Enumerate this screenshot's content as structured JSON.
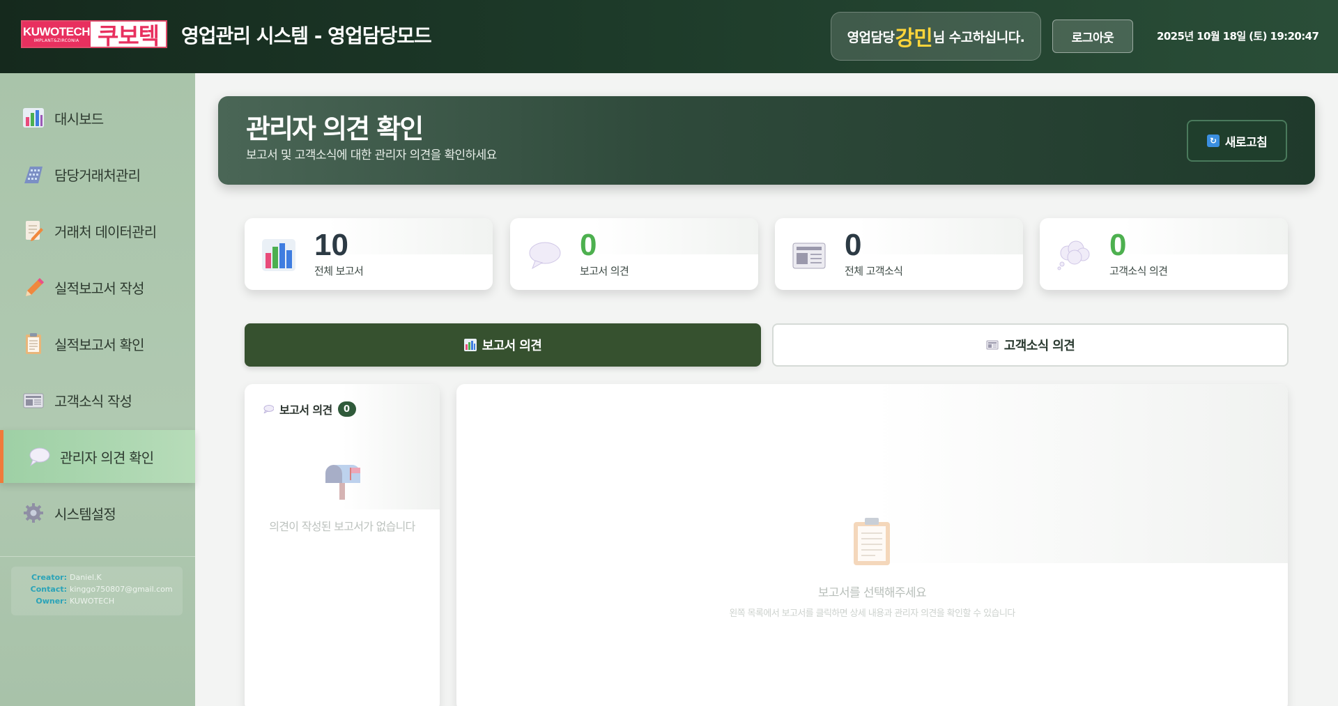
{
  "header": {
    "logo_en": "KUWOTECH",
    "logo_sub": "IMPLANT&ZIRCONIA",
    "logo_kr": "쿠보텍",
    "title": "영업관리 시스템 - 영업담당모드",
    "welcome_pre": "영업담당",
    "welcome_name": "강민",
    "welcome_post": "님 수고하십니다.",
    "logout_label": "로그아웃",
    "datetime": "2025년 10월 18일 (토) 19:20:47"
  },
  "sidebar": {
    "items": [
      {
        "label": "대시보드",
        "icon": "bar-chart-icon"
      },
      {
        "label": "담당거래처관리",
        "icon": "building-icon"
      },
      {
        "label": "거래처 데이터관리",
        "icon": "document-edit-icon"
      },
      {
        "label": "실적보고서 작성",
        "icon": "pencil-icon"
      },
      {
        "label": "실적보고서 확인",
        "icon": "clipboard-icon"
      },
      {
        "label": "고객소식 작성",
        "icon": "newspaper-icon"
      },
      {
        "label": "관리자 의견 확인",
        "icon": "speech-bubble-icon",
        "active": true
      },
      {
        "label": "시스템설정",
        "icon": "gear-icon"
      }
    ],
    "credits": {
      "creator_label": "Creator:",
      "creator": "Daniel.K",
      "contact_label": "Contact:",
      "contact": "kinggo750807@gmail.com",
      "owner_label": "Owner:",
      "owner": "KUWOTECH"
    }
  },
  "page": {
    "title": "관리자 의견 확인",
    "subtitle": "보고서 및 고객소식에 대한 관리자 의견을 확인하세요",
    "refresh_label": "새로고침"
  },
  "stats": [
    {
      "value": "10",
      "label": "전체 보고서",
      "icon": "bar-chart-icon"
    },
    {
      "value": "0",
      "label": "보고서 의견",
      "icon": "speech-bubble-icon"
    },
    {
      "value": "0",
      "label": "전체 고객소식",
      "icon": "newspaper-icon"
    },
    {
      "value": "0",
      "label": "고객소식 의견",
      "icon": "thought-bubble-icon"
    }
  ],
  "tabs": {
    "report": "보고서 의견",
    "news": "고객소식 의견"
  },
  "list": {
    "title": "보고서 의견",
    "count": "0",
    "empty": "의견이 작성된 보고서가 없습니다"
  },
  "detail": {
    "empty_title": "보고서를 선택해주세요",
    "empty_desc": "왼쪽 목록에서 보고서를 클릭하면 상세 내용과 관리자 의견을 확인할 수 있습니다"
  },
  "colors": {
    "header_dark": "#15291d",
    "sidebar": "#a9c4aa",
    "accent_green": "#4db04f",
    "active_tab": "#36512f",
    "active_marker": "#f07b3a",
    "name_highlight": "#ffd53a"
  }
}
